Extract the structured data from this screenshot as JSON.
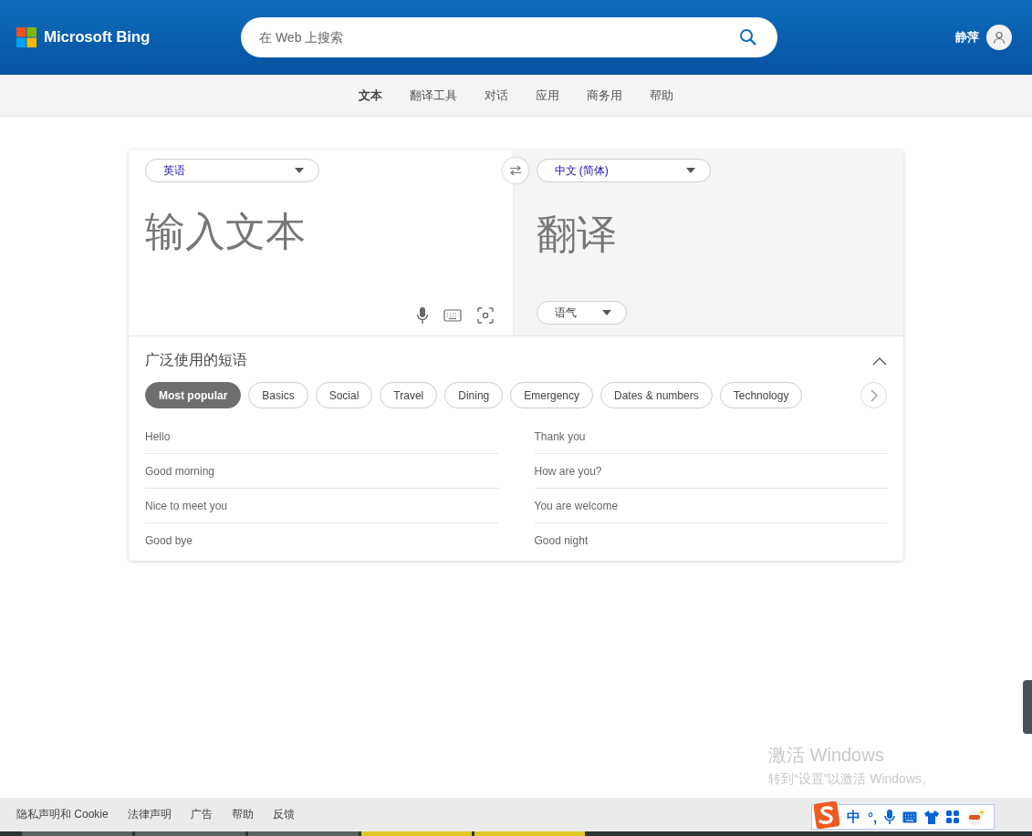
{
  "header": {
    "logo_text": "Microsoft Bing",
    "search": {
      "placeholder": "在 Web 上搜索"
    },
    "user_name": "静萍"
  },
  "nav": {
    "items": [
      {
        "label": "文本",
        "selected": true
      },
      {
        "label": "翻译工具",
        "selected": false
      },
      {
        "label": "对话",
        "selected": false
      },
      {
        "label": "应用",
        "selected": false
      },
      {
        "label": "商务用",
        "selected": false
      },
      {
        "label": "帮助",
        "selected": false
      }
    ]
  },
  "translator": {
    "source_language": "英语",
    "target_language": "中文 (简体)",
    "input": {
      "placeholder": "输入文本"
    },
    "output_placeholder": "翻译",
    "tone": "语气"
  },
  "phrases": {
    "title": "广泛使用的短语",
    "expanded": true,
    "categories": [
      {
        "label": "Most popular",
        "selected": true
      },
      {
        "label": "Basics",
        "selected": false
      },
      {
        "label": "Social",
        "selected": false
      },
      {
        "label": "Travel",
        "selected": false
      },
      {
        "label": "Dining",
        "selected": false
      },
      {
        "label": "Emergency",
        "selected": false
      },
      {
        "label": "Dates & numbers",
        "selected": false
      },
      {
        "label": "Technology",
        "selected": false
      }
    ],
    "left_column": [
      "Hello",
      "Good morning",
      "Nice to meet you",
      "Good bye"
    ],
    "right_column": [
      "Thank you",
      "How are you?",
      "You are welcome",
      "Good night"
    ]
  },
  "activation_notice": {
    "title": "激活 Windows",
    "subtitle": "转到“设置”以激活 Windows。"
  },
  "footer": {
    "links": [
      "隐私声明和 Cookie",
      "法律声明",
      "广告",
      "帮助",
      "反馈"
    ]
  },
  "ime_toolbar": {
    "mode": "中",
    "punctuation": "°,"
  }
}
